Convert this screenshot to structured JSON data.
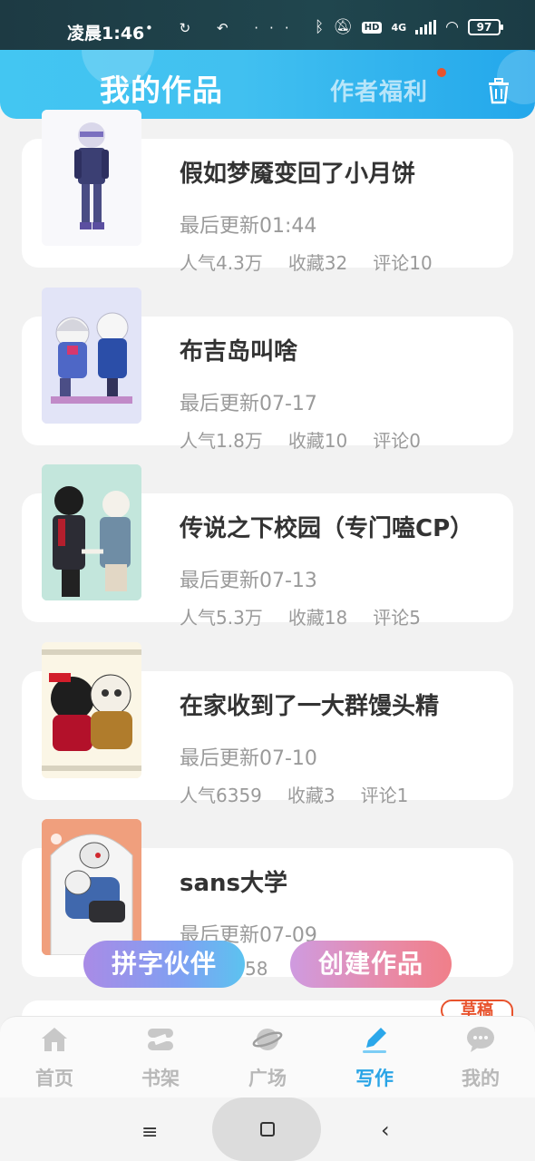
{
  "status_bar": {
    "time": "凌晨1:46",
    "notifications": "• ↻ ↶ ···",
    "network": "4G",
    "hd": "HD",
    "battery": "97"
  },
  "header": {
    "title": "我的作品",
    "perks": "作者福利"
  },
  "works": [
    {
      "title": "假如梦魇变回了小月饼",
      "updated": "最后更新01:44",
      "popularity": "人气4.3万",
      "favorites": "收藏32",
      "comments": "评论10"
    },
    {
      "title": "布吉岛叫啥",
      "updated": "最后更新07-17",
      "popularity": "人气1.8万",
      "favorites": "收藏10",
      "comments": "评论0"
    },
    {
      "title": "传说之下校园（专门嗑CP）",
      "updated": "最后更新07-13",
      "popularity": "人气5.3万",
      "favorites": "收藏18",
      "comments": "评论5"
    },
    {
      "title": "在家收到了一大群馒头精",
      "updated": "最后更新07-10",
      "popularity": "人气6359",
      "favorites": "收藏3",
      "comments": "评论1"
    },
    {
      "title": "sans大学",
      "updated": "最后更新07-09",
      "popularity": "58",
      "favorites": "",
      "comments": ""
    }
  ],
  "fab": {
    "partner": "拼字伙伴",
    "create": "创建作品"
  },
  "draft_tag": "草稿",
  "bottom_nav": [
    {
      "label": "首页",
      "icon": "home-icon"
    },
    {
      "label": "书架",
      "icon": "bookshelf-icon"
    },
    {
      "label": "广场",
      "icon": "planet-icon"
    },
    {
      "label": "写作",
      "icon": "pen-icon",
      "active": true
    },
    {
      "label": "我的",
      "icon": "chat-bubble-icon"
    }
  ],
  "system_nav": {
    "menu": "≡",
    "back": "‹"
  },
  "colors": {
    "header_accent": "#41c0f0",
    "active_tab": "#29a4e6",
    "perk_dot": "#e8532d"
  }
}
